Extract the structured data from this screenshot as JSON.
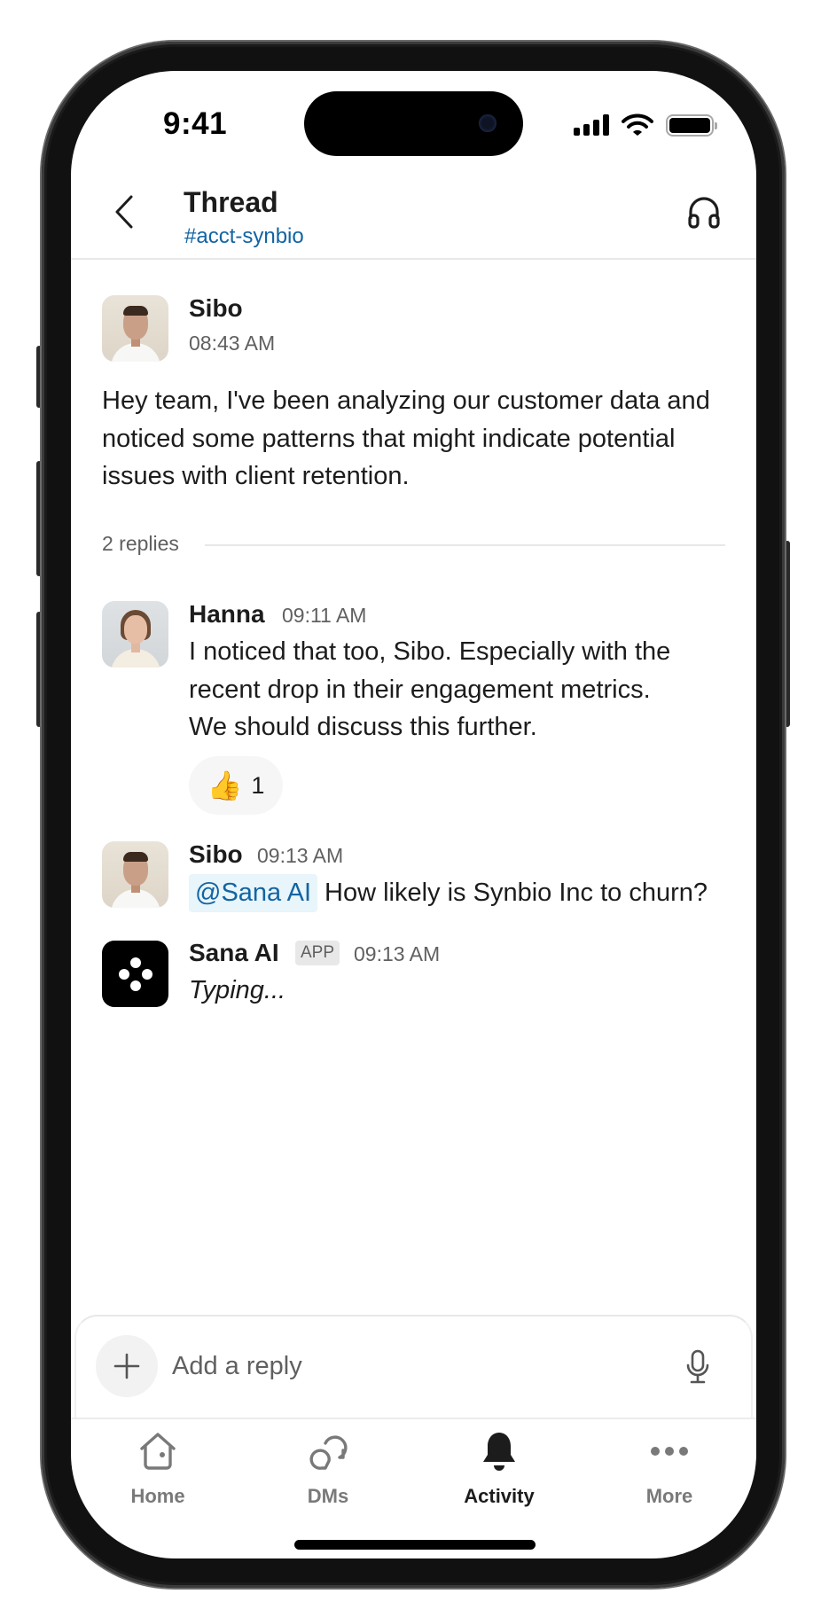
{
  "status_bar": {
    "time": "9:41",
    "icons": [
      "cellular-signal-icon",
      "wifi-icon",
      "battery-icon"
    ]
  },
  "header": {
    "back_icon": "chevron-left-icon",
    "title": "Thread",
    "channel": "#acct-synbio",
    "action_icon": "headphones-icon"
  },
  "parent_message": {
    "author": "Sibo",
    "time": "08:43 AM",
    "lines": [
      "Hey team, I've been analyzing our customer data and",
      "noticed some patterns that might indicate potential",
      "issues with client retention."
    ]
  },
  "replies_divider": {
    "label": "2 replies"
  },
  "replies": [
    {
      "author": "Hanna",
      "time": "09:11 AM",
      "lines": [
        "I noticed that too, Sibo. Especially with the",
        "recent drop in their engagement metrics.",
        "We should discuss this further."
      ],
      "reaction": {
        "emoji": "👍",
        "icon": "thumbs-up-icon",
        "count": "1"
      }
    },
    {
      "author": "Sibo",
      "time": "09:13 AM",
      "mention": "@Sana AI",
      "text": "How likely is Synbio Inc to churn?"
    },
    {
      "author": "Sana AI",
      "badge": "APP",
      "time": "09:13 AM",
      "status": "Typing..."
    }
  ],
  "composer": {
    "placeholder": "Add a reply",
    "value": "",
    "add_icon": "plus-icon",
    "mic_icon": "microphone-icon"
  },
  "nav": {
    "active": "Activity",
    "items": [
      {
        "label": "Home",
        "icon": "home-icon"
      },
      {
        "label": "DMs",
        "icon": "dms-icon"
      },
      {
        "label": "Activity",
        "icon": "bell-icon"
      },
      {
        "label": "More",
        "icon": "more-icon"
      }
    ]
  },
  "colors": {
    "link": "#1264a3",
    "mention_bg": "#e8f5fa",
    "text": "#1d1c1d",
    "muted": "#616061"
  }
}
